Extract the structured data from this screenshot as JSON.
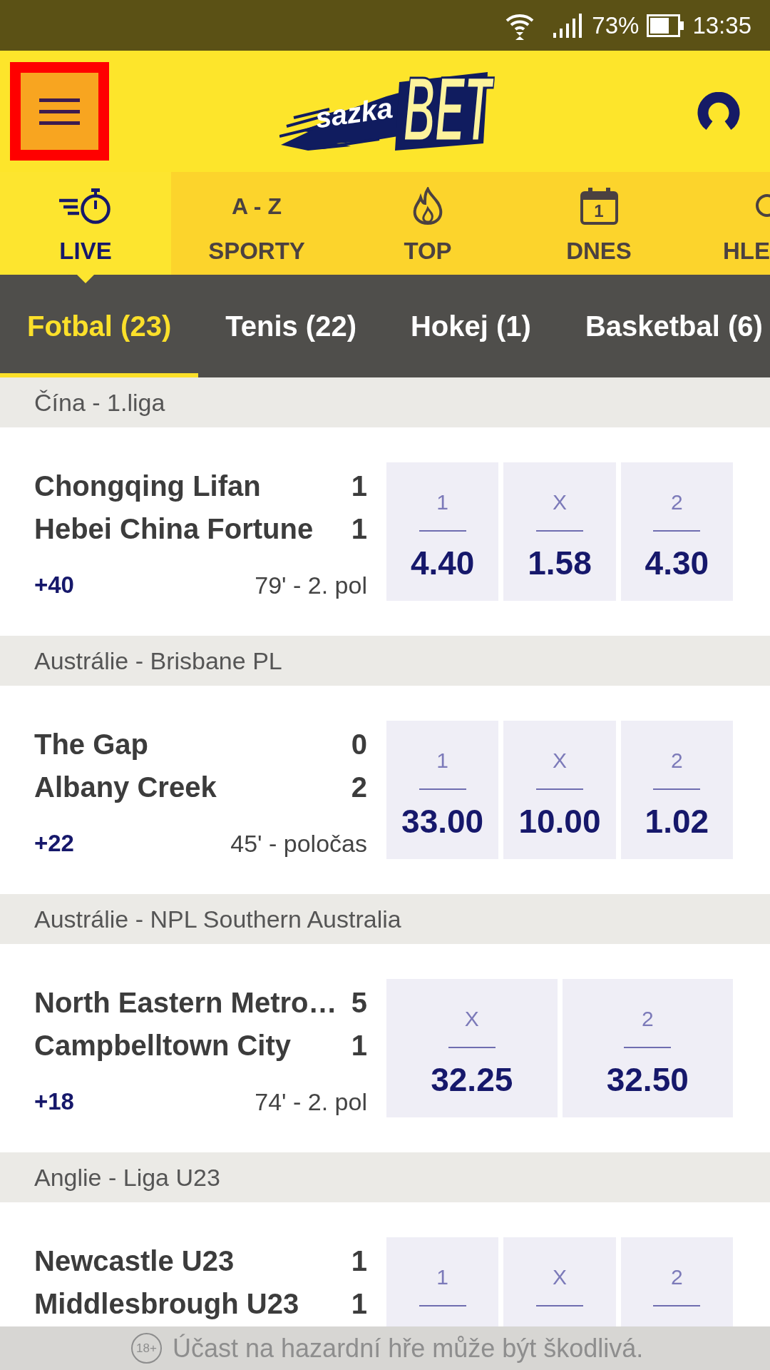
{
  "status_bar": {
    "battery": "73%",
    "time": "13:35"
  },
  "header": {
    "menu_button": {
      "highlighted": true
    },
    "logo": {
      "small_word": "sazka",
      "large_word": "BET"
    }
  },
  "category_tabs": [
    {
      "kind": "timer",
      "label": "LIVE",
      "selected": true
    },
    {
      "kind": "letters",
      "icon_text": "A - Z",
      "label": "SPORTY",
      "selected": false
    },
    {
      "kind": "flame",
      "label": "TOP",
      "selected": false
    },
    {
      "kind": "calendar",
      "icon_text": "1",
      "label": "DNES",
      "selected": false
    },
    {
      "kind": "magnifier",
      "label": "HLE",
      "selected": false
    }
  ],
  "sport_tabs": [
    {
      "label": "Fotbal (23)",
      "selected": true
    },
    {
      "label": "Tenis (22)",
      "selected": false
    },
    {
      "label": "Hokej (1)",
      "selected": false
    },
    {
      "label": "Basketbal (6)",
      "selected": false
    }
  ],
  "leagues": [
    {
      "name": "Čína - 1.liga",
      "matches": [
        {
          "teams": [
            {
              "name": "Chongqing Lifan",
              "score": "1"
            },
            {
              "name": "Hebei China Fortune",
              "score": "1"
            }
          ],
          "more_markets": "+40",
          "time": "79' - 2. pol",
          "odds": [
            {
              "outcome": "1",
              "value": "4.40"
            },
            {
              "outcome": "X",
              "value": "1.58"
            },
            {
              "outcome": "2",
              "value": "4.30"
            }
          ]
        }
      ]
    },
    {
      "name": "Austrálie - Brisbane PL",
      "matches": [
        {
          "teams": [
            {
              "name": "The Gap",
              "score": "0"
            },
            {
              "name": "Albany Creek",
              "score": "2"
            }
          ],
          "more_markets": "+22",
          "time": "45' - poločas",
          "odds": [
            {
              "outcome": "1",
              "value": "33.00"
            },
            {
              "outcome": "X",
              "value": "10.00"
            },
            {
              "outcome": "2",
              "value": "1.02"
            }
          ]
        }
      ]
    },
    {
      "name": "Austrálie - NPL Southern Australia",
      "matches": [
        {
          "teams": [
            {
              "name": "North Eastern Metro…",
              "score": "5"
            },
            {
              "name": "Campbelltown City",
              "score": "1"
            }
          ],
          "more_markets": "+18",
          "time": "74' - 2. pol",
          "odds": [
            {
              "outcome": "X",
              "value": "32.25"
            },
            {
              "outcome": "2",
              "value": "32.50"
            }
          ]
        }
      ]
    },
    {
      "name": "Anglie - Liga U23",
      "matches": [
        {
          "teams": [
            {
              "name": "Newcastle U23",
              "score": "1"
            },
            {
              "name": "Middlesbrough U23",
              "score": "1"
            }
          ],
          "odds": [
            {
              "outcome": "1"
            },
            {
              "outcome": "X"
            },
            {
              "outcome": "2"
            }
          ]
        }
      ]
    }
  ],
  "footer": {
    "age_badge": "18+",
    "text": "Účast na hazardní hře může být škodlivá."
  }
}
